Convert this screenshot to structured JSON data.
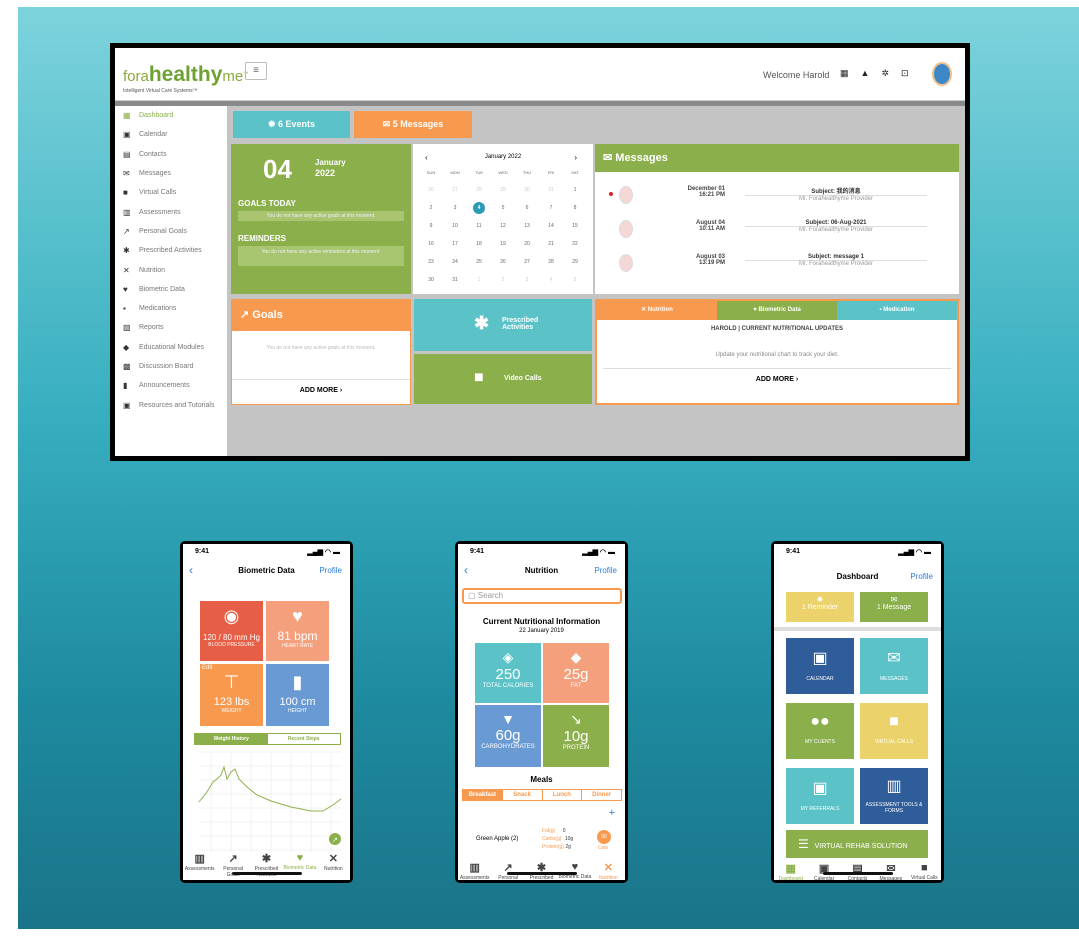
{
  "desktop": {
    "logo": {
      "pre": "fora",
      "brand": "healthy",
      "post": "me",
      "tm": "™",
      "tagline": "Intelligent Virtual Care Systems™"
    },
    "header": {
      "menu_icon": "≡",
      "welcome": "Welcome Harold"
    },
    "sidebar": [
      {
        "label": "Dashboard",
        "icon": "▦"
      },
      {
        "label": "Calendar",
        "icon": "▣"
      },
      {
        "label": "Contacts",
        "icon": "▤"
      },
      {
        "label": "Messages",
        "icon": "✉"
      },
      {
        "label": "Virtual Calls",
        "icon": "■"
      },
      {
        "label": "Assessments",
        "icon": "▥"
      },
      {
        "label": "Personal Goals",
        "icon": "↗"
      },
      {
        "label": "Prescribed Activities",
        "icon": "✱"
      },
      {
        "label": "Nutrition",
        "icon": "✕"
      },
      {
        "label": "Biometric Data",
        "icon": "♥"
      },
      {
        "label": "Medications",
        "icon": "▪"
      },
      {
        "label": "Reports",
        "icon": "▧"
      },
      {
        "label": "Educational Modules",
        "icon": "◆"
      },
      {
        "label": "Discussion Board",
        "icon": "▩"
      },
      {
        "label": "Announcements",
        "icon": "▮"
      },
      {
        "label": "Resources and Tutorials",
        "icon": "▣"
      }
    ],
    "events_btn": "6 Events",
    "messages_btn": "5 Messages",
    "date": {
      "day": "04",
      "month": "January",
      "year": "2022"
    },
    "goals_today": {
      "title": "GOALS TODAY",
      "text": "You do not have any active goals at this moment."
    },
    "reminders": {
      "title": "REMINDERS",
      "text": "You do not have any active reminders at this moment."
    },
    "calendar": {
      "title": "January 2022",
      "prev": "‹",
      "next": "›",
      "days": [
        "SUN",
        "MON",
        "TUE",
        "WED",
        "THU",
        "FRI",
        "SAT"
      ],
      "rows": [
        [
          "26",
          "27",
          "28",
          "29",
          "30",
          "31",
          "1"
        ],
        [
          "2",
          "3",
          "4",
          "5",
          "6",
          "7",
          "8"
        ],
        [
          "9",
          "10",
          "11",
          "12",
          "13",
          "14",
          "15"
        ],
        [
          "16",
          "17",
          "18",
          "19",
          "20",
          "21",
          "22"
        ],
        [
          "23",
          "24",
          "25",
          "26",
          "27",
          "28",
          "29"
        ],
        [
          "30",
          "31",
          "1",
          "2",
          "3",
          "4",
          "5"
        ]
      ],
      "selected": "4"
    },
    "messages": {
      "title": "Messages",
      "items": [
        {
          "date": "December 01",
          "time": "16:21 PM",
          "subject": "Subject: 我的消息",
          "from": "Mr. Forahealthyme Provider",
          "unread": true
        },
        {
          "date": "August 04",
          "time": "10:11 AM",
          "subject": "Subject: 06-Aug-2021",
          "from": "Mr. Forahealthyme Provider",
          "unread": false
        },
        {
          "date": "August 03",
          "time": "13:19 PM",
          "subject": "Subject: message 1",
          "from": "Mr. Forahealthyme Provider",
          "unread": false
        }
      ]
    },
    "goals": {
      "title": "Goals",
      "text": "You do not have any active goals at this moment.",
      "add": "ADD MORE"
    },
    "prescribed": "Prescribed Activities",
    "video": "Video Calls",
    "tabs": [
      "Nutrition",
      "Biometric Data",
      "Medication"
    ],
    "nutrition": {
      "title": "HAROLD | CURRENT NUTRITIONAL UPDATES",
      "text": "Update your nutritional chart to track your diet.",
      "add": "ADD MORE"
    }
  },
  "phone1": {
    "time": "9:41",
    "title": "Biometric Data",
    "profile": "Profile",
    "tiles": [
      {
        "value": "120 / 80 mm Hg",
        "label": "BLOOD PRESSURE"
      },
      {
        "value": "81 bpm",
        "label": "HEART RATE"
      },
      {
        "value": "123 lbs",
        "label": "WEIGHT"
      },
      {
        "value": "100 cm",
        "label": "HEIGHT"
      }
    ],
    "edit": "Edit",
    "tabs": [
      "Weight History",
      "Recent Steps"
    ],
    "nav": [
      "Assessments",
      "Personal Goals",
      "Prescribed Activities",
      "Biometric Data",
      "Nutrition"
    ]
  },
  "phone2": {
    "time": "9:41",
    "title": "Nutrition",
    "profile": "Profile",
    "search": "Search",
    "heading": "Current Nutritional Information",
    "date": "22 January 2019",
    "tiles": [
      {
        "value": "250",
        "label": "TOTAL CALORIES"
      },
      {
        "value": "25g",
        "label": "FAT"
      },
      {
        "value": "60g",
        "label": "CARBOHYDRATES"
      },
      {
        "value": "10g",
        "label": "PROTEIN"
      }
    ],
    "meals": "Meals",
    "meal_tabs": [
      "Breakfast",
      "Snack",
      "Lunch",
      "Dinner"
    ],
    "item": {
      "name": "Green Apple (2)",
      "fat_l": "Fat(g)",
      "fat": "0",
      "carb_l": "Carbs(g)",
      "carb": "10g",
      "prot_l": "Protein(g)",
      "prot": "2g",
      "cal": "50",
      "cal_l": "Cals"
    },
    "nav": [
      "Assessments",
      "Personal Goals",
      "Prescribed Activities",
      "Biometric Data",
      "Nutrition"
    ]
  },
  "phone3": {
    "time": "9:41",
    "title": "Dashboard",
    "profile": "Profile",
    "reminder": "1 Reminder",
    "message": "1 Message",
    "tiles": [
      {
        "label": "CALENDAR"
      },
      {
        "label": "MESSAGES"
      },
      {
        "label": "MY CLIENTS"
      },
      {
        "label": "VIRTUAL CALLS"
      },
      {
        "label": "MY REFERRALS"
      },
      {
        "label": "ASSESSMENT TOOLS & FORMS"
      }
    ],
    "rehab": "VIRTUAL REHAB SOLUTION",
    "nav": [
      "Dashboard",
      "Calendar",
      "Contacts",
      "Messages",
      "Virtual Calls"
    ]
  }
}
